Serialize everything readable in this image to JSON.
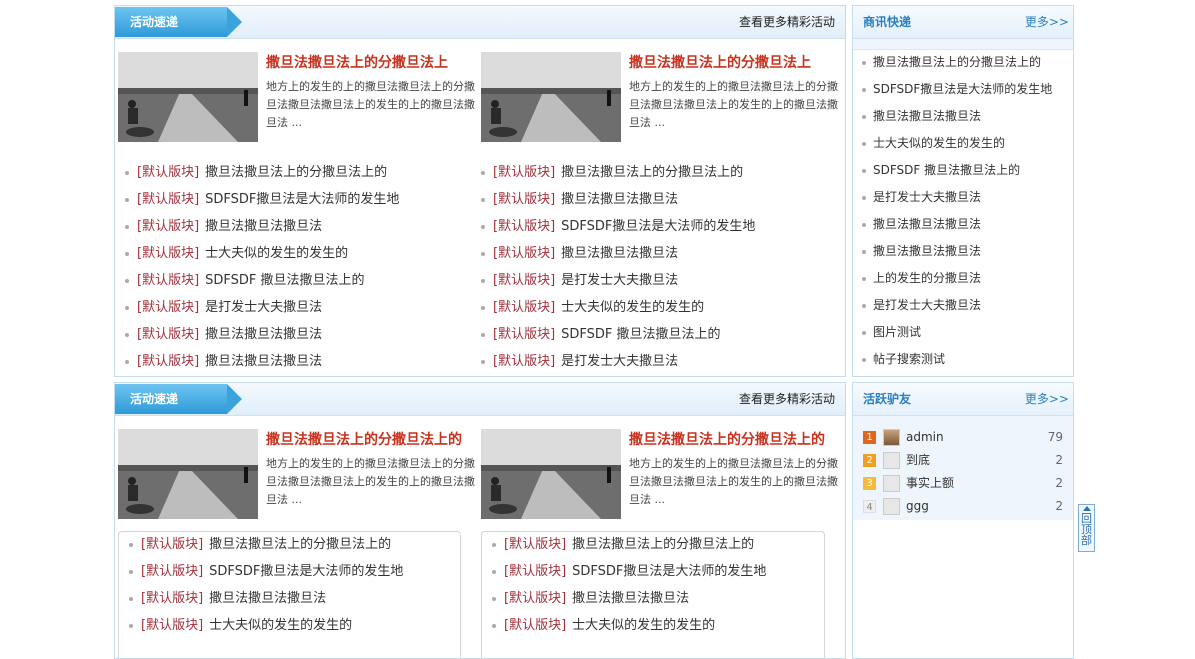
{
  "panel_top": {
    "tag": "活动速递",
    "more": "查看更多精彩活动",
    "features": [
      {
        "title": "撒旦法撒旦法上的分撒旦法上",
        "desc": "地方上的发生的上的撒旦法撒旦法上的分撒旦法撒旦法撒旦法上的发生的上的撒旦法撒旦法 ..."
      },
      {
        "title": "撒旦法撒旦法上的分撒旦法上",
        "desc": "地方上的发生的上的撒旦法撒旦法上的分撒旦法撒旦法撒旦法上的发生的上的撒旦法撒旦法 ..."
      }
    ],
    "list_left": [
      {
        "cat": "[默认版块]",
        "text": "撒旦法撒旦法上的分撒旦法上的"
      },
      {
        "cat": "[默认版块]",
        "text": "SDFSDF撒旦法是大法师的发生地"
      },
      {
        "cat": "[默认版块]",
        "text": "撒旦法撒旦法撒旦法"
      },
      {
        "cat": "[默认版块]",
        "text": "士大夫似的发生的发生的"
      },
      {
        "cat": "[默认版块]",
        "text": "SDFSDF 撒旦法撒旦法上的"
      },
      {
        "cat": "[默认版块]",
        "text": "是打发士大夫撒旦法"
      },
      {
        "cat": "[默认版块]",
        "text": "撒旦法撒旦法撒旦法"
      },
      {
        "cat": "[默认版块]",
        "text": "撒旦法撒旦法撒旦法"
      }
    ],
    "list_right": [
      {
        "cat": "[默认版块]",
        "text": "撒旦法撒旦法上的分撒旦法上的"
      },
      {
        "cat": "[默认版块]",
        "text": "撒旦法撒旦法撒旦法"
      },
      {
        "cat": "[默认版块]",
        "text": "SDFSDF撒旦法是大法师的发生地"
      },
      {
        "cat": "[默认版块]",
        "text": "撒旦法撒旦法撒旦法"
      },
      {
        "cat": "[默认版块]",
        "text": "是打发士大夫撒旦法"
      },
      {
        "cat": "[默认版块]",
        "text": "士大夫似的发生的发生的"
      },
      {
        "cat": "[默认版块]",
        "text": "SDFSDF 撒旦法撒旦法上的"
      },
      {
        "cat": "[默认版块]",
        "text": "是打发士大夫撒旦法"
      }
    ]
  },
  "panel_bottom": {
    "tag": "活动速递",
    "more": "查看更多精彩活动",
    "features": [
      {
        "title": "撒旦法撒旦法上的分撒旦法上的",
        "desc": "地方上的发生的上的撒旦法撒旦法上的分撒旦法撒旦法撒旦法上的发生的上的撒旦法撒旦法 ..."
      },
      {
        "title": "撒旦法撒旦法上的分撒旦法上的",
        "desc": "地方上的发生的上的撒旦法撒旦法上的分撒旦法撒旦法撒旦法上的发生的上的撒旦法撒旦法 ..."
      }
    ],
    "list_left": [
      {
        "cat": "[默认版块]",
        "text": "撒旦法撒旦法上的分撒旦法上的"
      },
      {
        "cat": "[默认版块]",
        "text": "SDFSDF撒旦法是大法师的发生地"
      },
      {
        "cat": "[默认版块]",
        "text": "撒旦法撒旦法撒旦法"
      },
      {
        "cat": "[默认版块]",
        "text": "士大夫似的发生的发生的"
      }
    ],
    "list_right": [
      {
        "cat": "[默认版块]",
        "text": "撒旦法撒旦法上的分撒旦法上的"
      },
      {
        "cat": "[默认版块]",
        "text": "SDFSDF撒旦法是大法师的发生地"
      },
      {
        "cat": "[默认版块]",
        "text": "撒旦法撒旦法撒旦法"
      },
      {
        "cat": "[默认版块]",
        "text": "士大夫似的发生的发生的"
      }
    ]
  },
  "side_news": {
    "title": "商讯快递",
    "more": "更多>>",
    "items": [
      "撒旦法撒旦法上的分撒旦法上的",
      "SDFSDF撒旦法是大法师的发生地",
      "撒旦法撒旦法撒旦法",
      "士大夫似的发生的发生的",
      "SDFSDF 撒旦法撒旦法上的",
      "是打发士大夫撒旦法",
      "撒旦法撒旦法撒旦法",
      "撒旦法撒旦法撒旦法",
      "上的发生的分撒旦法",
      "是打发士大夫撒旦法",
      "图片测试",
      "帖子搜索测试"
    ]
  },
  "side_users": {
    "title": "活跃驴友",
    "more": "更多>>",
    "users": [
      {
        "rank": "1",
        "name": "admin",
        "count": "79",
        "rank_color": "#e0661e"
      },
      {
        "rank": "2",
        "name": "到底",
        "count": "2",
        "rank_color": "#f0a01e"
      },
      {
        "rank": "3",
        "name": "事实上额",
        "count": "2",
        "rank_color": "#f5bb3c"
      },
      {
        "rank": "4",
        "name": "ggg",
        "count": "2",
        "rank_color": "#efefef"
      }
    ]
  },
  "to_top": "回顶部",
  "icons": {
    "thumb": "road-photo-thumbnail",
    "avatar": "user-avatar-icon",
    "up": "arrow-up-icon"
  }
}
